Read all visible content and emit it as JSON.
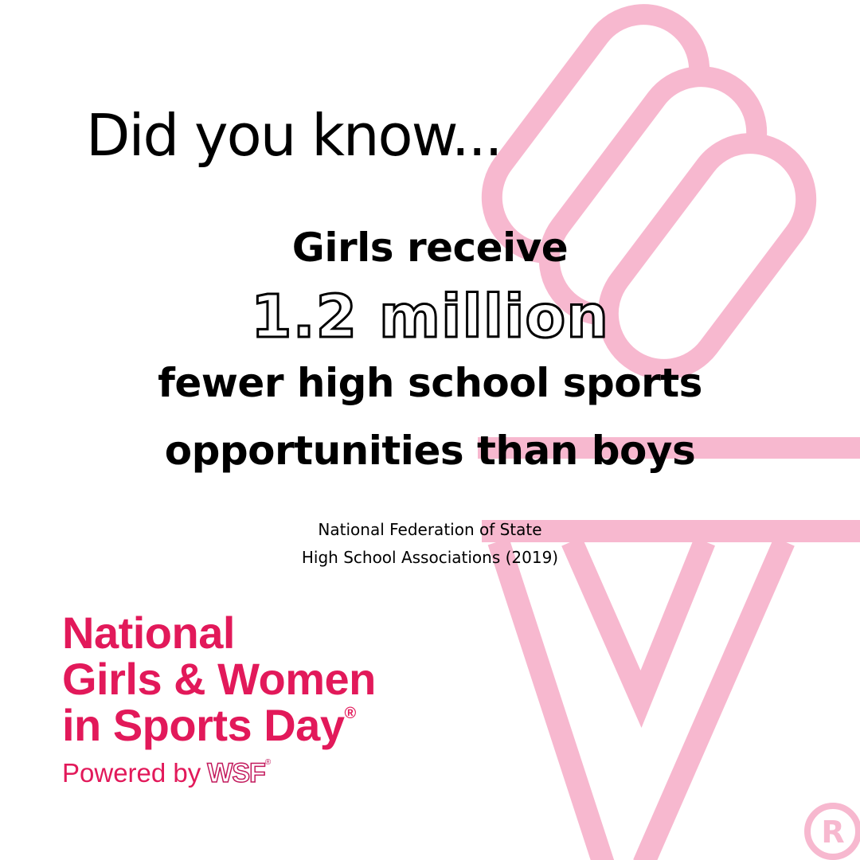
{
  "intro": "Did you know...",
  "statement": {
    "line1": "Girls receive",
    "highlight": "1.2 million",
    "line3": "fewer high school sports",
    "line4": "opportunities than boys"
  },
  "citation": {
    "line1": "National Federation of State",
    "line2": "High School Associations (2019)"
  },
  "logo": {
    "line1": "National",
    "line2": "Girls & Women",
    "line3": "in Sports Day",
    "registered": "®",
    "powered_by": "Powered by",
    "partner": "WSF",
    "partner_registered": "®"
  },
  "watermark_registered": "R",
  "colors": {
    "brand": "#e2195a",
    "watermark": "#f7b8cf"
  }
}
